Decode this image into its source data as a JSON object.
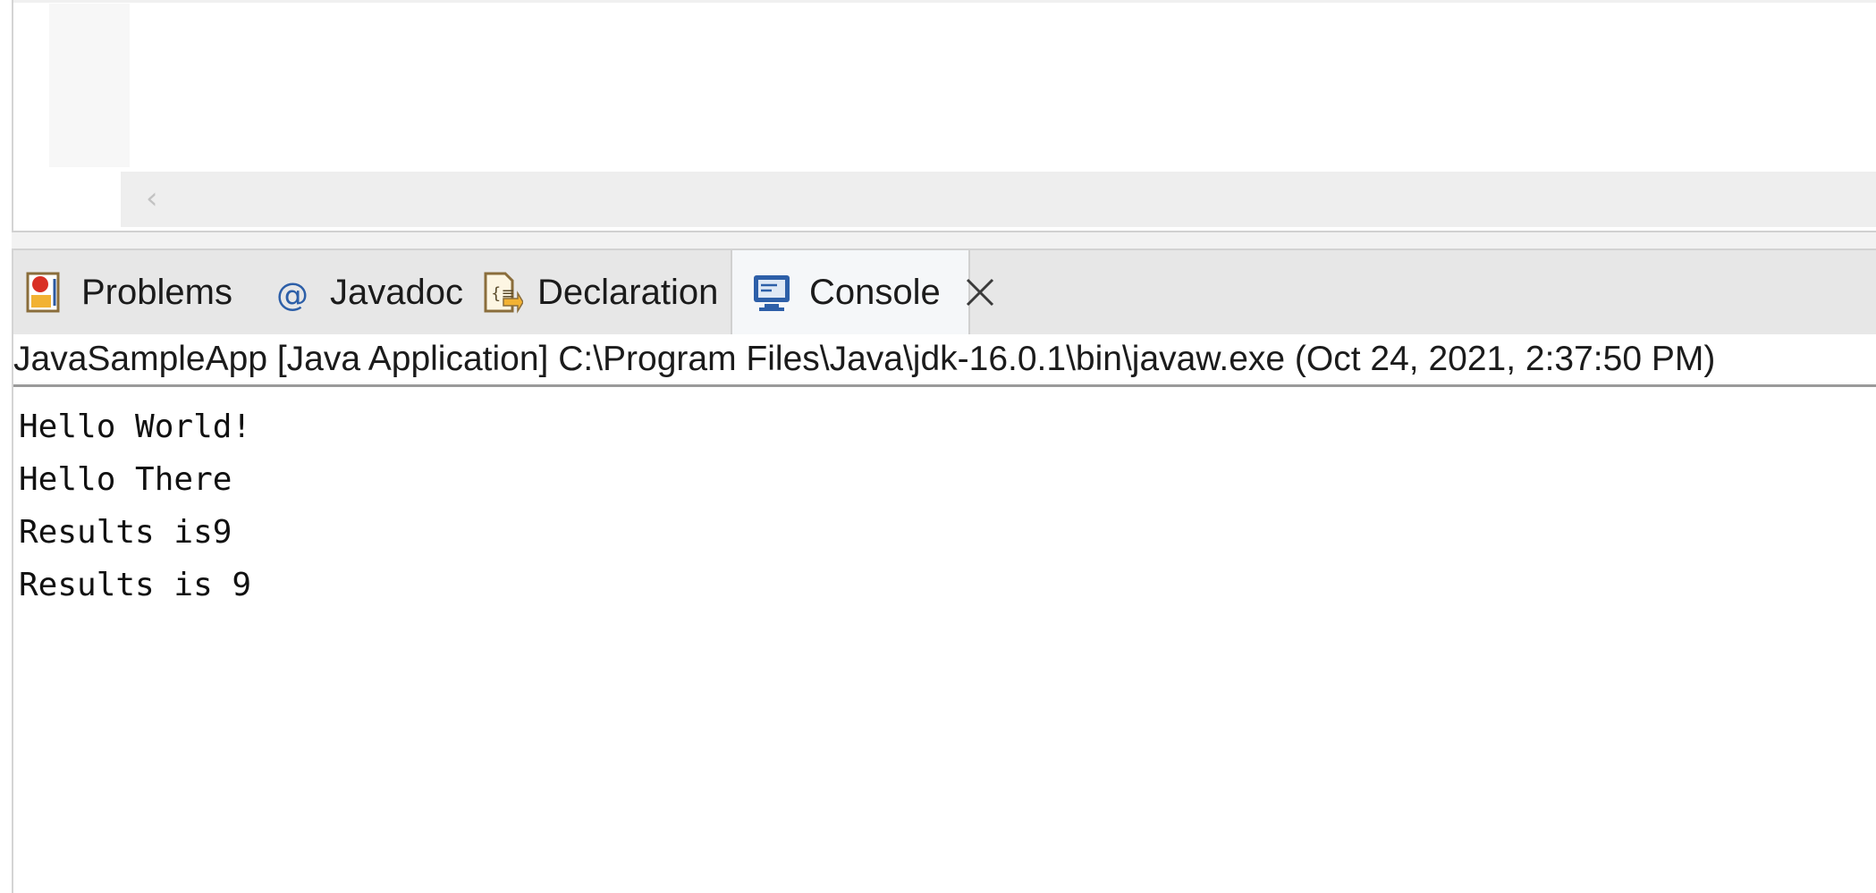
{
  "editor": {
    "scroll_left_glyph": "‹"
  },
  "tabs": [
    {
      "label": "Problems",
      "icon": "problems-icon",
      "active": false
    },
    {
      "label": "Javadoc",
      "icon": "at-sign-icon",
      "active": false
    },
    {
      "label": "Declaration",
      "icon": "declaration-icon",
      "active": false
    },
    {
      "label": "Console",
      "icon": "console-icon",
      "active": true
    }
  ],
  "console": {
    "launch_info": "JavaSampleApp [Java Application] C:\\Program Files\\Java\\jdk-16.0.1\\bin\\javaw.exe  (Oct 24, 2021, 2:37:50 PM)",
    "lines": [
      "Hello World!",
      "Hello There",
      "Results is9",
      "Results is 9"
    ]
  },
  "colors": {
    "tab_bar_bg": "#e7e7e7",
    "active_tab_bg": "#f5f7f9",
    "console_icon_blue": "#2d5fa8",
    "problems_icon_red": "#d93025"
  }
}
